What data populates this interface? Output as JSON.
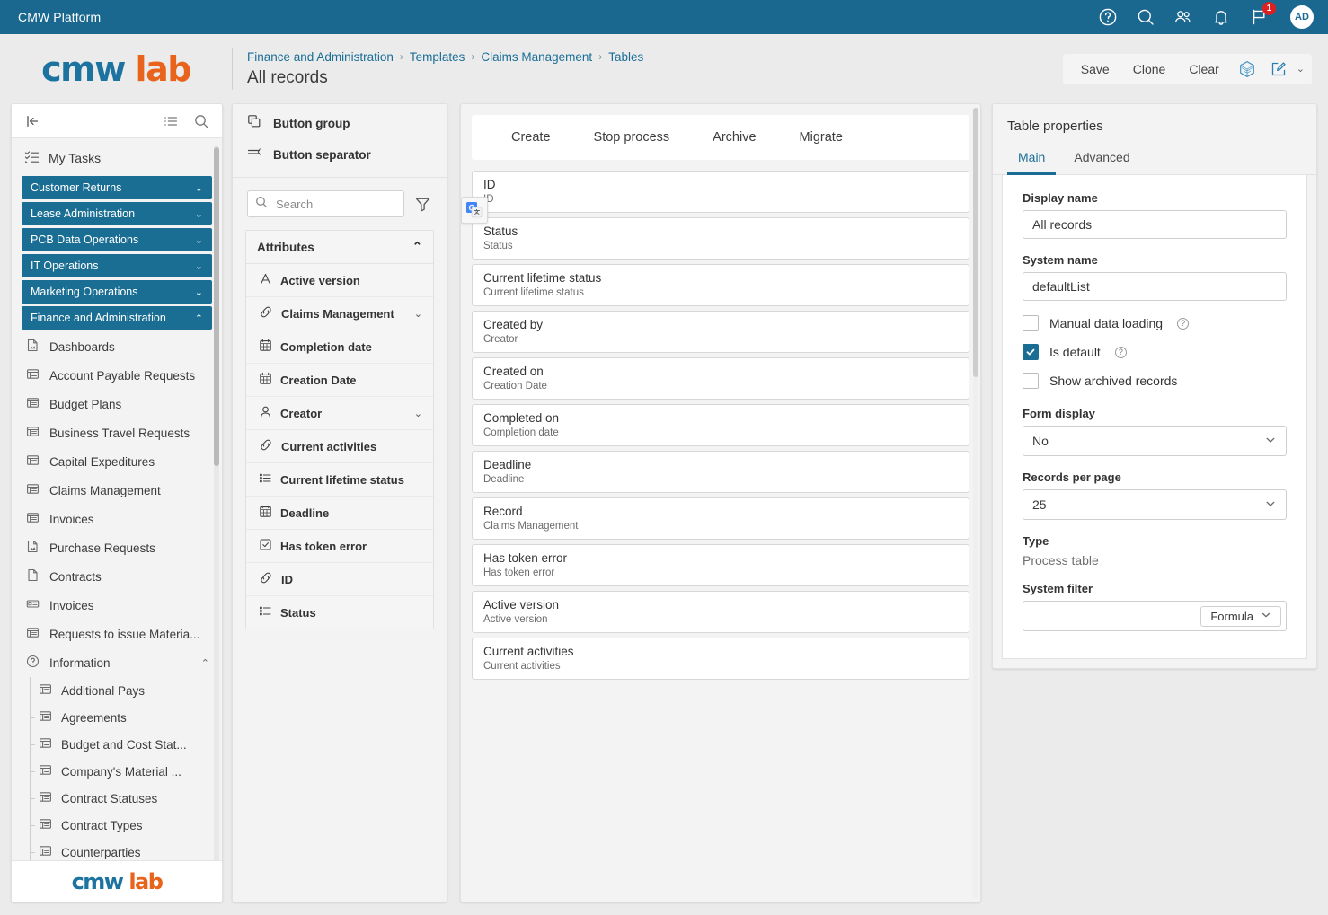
{
  "topbar": {
    "title": "CMW Platform",
    "icons": [
      "help-icon",
      "search-icon",
      "users-icon",
      "bell-icon",
      "flag-icon"
    ],
    "notification_count": "1",
    "avatar_initials": "AD"
  },
  "header": {
    "logo_part1": "cmw",
    "logo_part2": "lab",
    "breadcrumb": [
      "Finance and Administration",
      "Templates",
      "Claims Management",
      "Tables"
    ],
    "breadcrumb_separator": "›",
    "page_title": "All records",
    "actions": {
      "save": "Save",
      "clone": "Clone",
      "clear": "Clear",
      "hexagon_icon": "hexagon-icon",
      "edit_icon": "edit-pencil-icon",
      "caret": "⌄"
    }
  },
  "sidebar": {
    "toolbar": {
      "collapse_icon": "collapse-left-icon",
      "list_icon": "list-icon",
      "search_icon": "search-icon"
    },
    "my_tasks": "My Tasks",
    "groups": [
      {
        "label": "Customer Returns",
        "expanded": false,
        "chevron": "⌄"
      },
      {
        "label": "Lease Administration",
        "expanded": false,
        "chevron": "⌄"
      },
      {
        "label": "PCB Data Operations",
        "expanded": false,
        "chevron": "⌄"
      },
      {
        "label": "IT Operations",
        "expanded": false,
        "chevron": "⌄"
      },
      {
        "label": "Marketing Operations",
        "expanded": false,
        "chevron": "⌄"
      },
      {
        "label": "Finance and Administration",
        "expanded": true,
        "chevron": "⌃"
      }
    ],
    "items": [
      {
        "label": "Dashboards",
        "icon": "document-image-icon"
      },
      {
        "label": "Account Payable Requests",
        "icon": "table-icon"
      },
      {
        "label": "Budget Plans",
        "icon": "table-icon"
      },
      {
        "label": "Business Travel Requests",
        "icon": "table-icon"
      },
      {
        "label": "Capital Expeditures",
        "icon": "table-icon"
      },
      {
        "label": "Claims Management",
        "icon": "table-icon"
      },
      {
        "label": "Invoices",
        "icon": "table-icon"
      },
      {
        "label": "Purchase Requests",
        "icon": "document-image-icon"
      },
      {
        "label": "Contracts",
        "icon": "document-icon"
      },
      {
        "label": "Invoices",
        "icon": "card-icon"
      },
      {
        "label": "Requests to issue Materia...",
        "icon": "table-icon"
      }
    ],
    "information": {
      "label": "Information",
      "icon": "question-circle-icon",
      "chevron": "⌃"
    },
    "sub_items": [
      {
        "label": "Additional Pays",
        "icon": "table-icon"
      },
      {
        "label": "Agreements",
        "icon": "table-icon"
      },
      {
        "label": "Budget and Cost Stat...",
        "icon": "table-icon"
      },
      {
        "label": "Company's Material ...",
        "icon": "table-icon"
      },
      {
        "label": "Contract Statuses",
        "icon": "table-icon"
      },
      {
        "label": "Contract Types",
        "icon": "table-icon"
      },
      {
        "label": "Counterparties",
        "icon": "table-icon"
      }
    ],
    "footer_logo1": "cmw",
    "footer_logo2": "lab"
  },
  "attributes_panel": {
    "button_group": "Button group",
    "button_separator": "Button separator",
    "search_placeholder": "Search",
    "search_value": "",
    "filter_icon": "funnel-filter-icon",
    "section_title": "Attributes",
    "section_chevron": "⌃",
    "items": [
      {
        "label": "Active version",
        "icon": "text-a-icon",
        "chevron": ""
      },
      {
        "label": "Claims Management",
        "icon": "link-icon",
        "chevron": "⌄"
      },
      {
        "label": "Completion date",
        "icon": "calendar-icon",
        "chevron": ""
      },
      {
        "label": "Creation Date",
        "icon": "calendar-icon",
        "chevron": ""
      },
      {
        "label": "Creator",
        "icon": "user-icon",
        "chevron": "⌄"
      },
      {
        "label": "Current activities",
        "icon": "link-icon",
        "chevron": ""
      },
      {
        "label": "Current lifetime status",
        "icon": "list-bullets-icon",
        "chevron": ""
      },
      {
        "label": "Deadline",
        "icon": "calendar-icon",
        "chevron": ""
      },
      {
        "label": "Has token error",
        "icon": "checkbox-icon",
        "chevron": ""
      },
      {
        "label": "ID",
        "icon": "link-icon",
        "chevron": ""
      },
      {
        "label": "Status",
        "icon": "list-bullets-icon",
        "chevron": ""
      }
    ]
  },
  "canvas": {
    "toolbar_buttons": [
      "Create",
      "Stop process",
      "Archive",
      "Migrate"
    ],
    "translate_badge_icon": "google-translate-icon",
    "fields": [
      {
        "title": "ID",
        "subtitle": "ID"
      },
      {
        "title": "Status",
        "subtitle": "Status"
      },
      {
        "title": "Current lifetime status",
        "subtitle": "Current lifetime status"
      },
      {
        "title": "Created by",
        "subtitle": "Creator"
      },
      {
        "title": "Created on",
        "subtitle": "Creation Date"
      },
      {
        "title": "Completed on",
        "subtitle": "Completion date"
      },
      {
        "title": "Deadline",
        "subtitle": "Deadline"
      },
      {
        "title": "Record",
        "subtitle": "Claims Management"
      },
      {
        "title": "Has token error",
        "subtitle": "Has token error"
      },
      {
        "title": "Active version",
        "subtitle": "Active version"
      },
      {
        "title": "Current activities",
        "subtitle": "Current activities"
      }
    ]
  },
  "properties": {
    "title": "Table properties",
    "tabs": [
      {
        "label": "Main",
        "active": true
      },
      {
        "label": "Advanced",
        "active": false
      }
    ],
    "display_name_label": "Display name",
    "display_name_value": "All records",
    "system_name_label": "System name",
    "system_name_value": "defaultList",
    "manual_data_loading": {
      "label": "Manual data loading",
      "checked": false,
      "help": "?"
    },
    "is_default": {
      "label": "Is default",
      "checked": true,
      "help": "?"
    },
    "show_archived": {
      "label": "Show archived records",
      "checked": false
    },
    "form_display_label": "Form display",
    "form_display_value": "No",
    "records_per_page_label": "Records per page",
    "records_per_page_value": "25",
    "type_label": "Type",
    "type_value": "Process table",
    "system_filter_label": "System filter",
    "system_filter_value": "",
    "formula_button": "Formula",
    "chevron": "⌄"
  },
  "colors": {
    "brand_teal": "#1a6890",
    "group_teal": "#1a6e93",
    "link_blue": "#1a6e96",
    "logo_blue": "#1c73a0",
    "logo_orange": "#e8641c",
    "badge_red": "#e02020"
  }
}
